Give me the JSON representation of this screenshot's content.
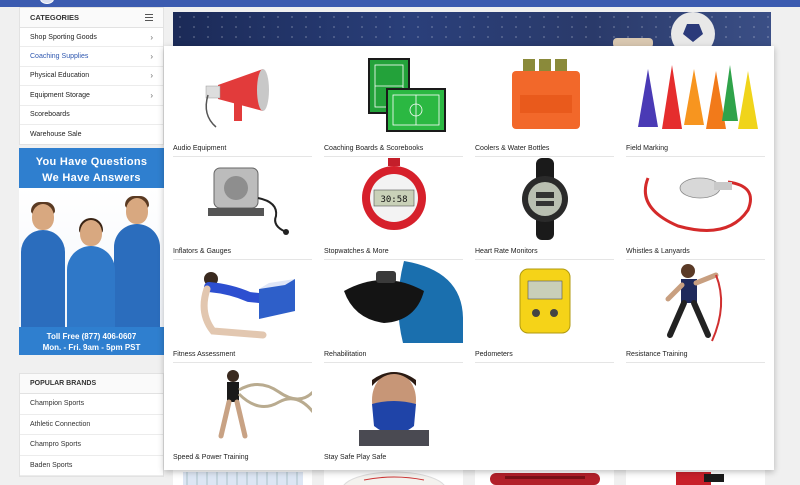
{
  "sidebar": {
    "header": "CATEGORIES",
    "items": [
      {
        "label": "Shop Sporting Goods",
        "chevron": true
      },
      {
        "label": "Coaching Supplies",
        "chevron": true,
        "active": true
      },
      {
        "label": "Physical Education",
        "chevron": true
      },
      {
        "label": "Equipment Storage",
        "chevron": true
      },
      {
        "label": "Scoreboards",
        "chevron": false
      },
      {
        "label": "Warehouse Sale",
        "chevron": false
      }
    ]
  },
  "promo": {
    "title_line1": "You Have Questions",
    "title_line2": "We Have Answers",
    "footer_line1": "Toll Free (877) 406-0607",
    "footer_line2": "Mon. - Fri.  9am - 5pm PST"
  },
  "brands": {
    "header": "POPULAR BRANDS",
    "items": [
      "Champion Sports",
      "Athletic Connection",
      "Champro Sports",
      "Baden Sports"
    ]
  },
  "mega_menu": {
    "tiles": [
      {
        "label": "Audio Equipment",
        "icon": "megaphone-icon"
      },
      {
        "label": "Coaching Boards & Scorebooks",
        "icon": "coaching-board-icon"
      },
      {
        "label": "Coolers & Water Bottles",
        "icon": "water-bottle-carrier-icon"
      },
      {
        "label": "Field Marking",
        "icon": "cones-icon"
      },
      {
        "label": "Inflators & Gauges",
        "icon": "air-compressor-icon"
      },
      {
        "label": "Stopwatches & More",
        "icon": "stopwatch-icon"
      },
      {
        "label": "Heart Rate Monitors",
        "icon": "watch-icon"
      },
      {
        "label": "Whistles & Lanyards",
        "icon": "whistle-icon"
      },
      {
        "label": "Fitness Assessment",
        "icon": "sit-and-reach-icon"
      },
      {
        "label": "Rehabilitation",
        "icon": "ice-bag-icon"
      },
      {
        "label": "Pedometers",
        "icon": "pedometer-icon"
      },
      {
        "label": "Resistance Training",
        "icon": "resistance-band-icon"
      },
      {
        "label": "Speed & Power Training",
        "icon": "battle-rope-icon"
      },
      {
        "label": "Stay Safe Play Safe",
        "icon": "face-mask-icon"
      }
    ],
    "stopwatch_display": "30:58",
    "cooler_brand": "GSERIES 02"
  },
  "colors": {
    "accent": "#2f58b0",
    "topbar": "#3b5bb0",
    "promo_blue": "#2f7fcf"
  }
}
